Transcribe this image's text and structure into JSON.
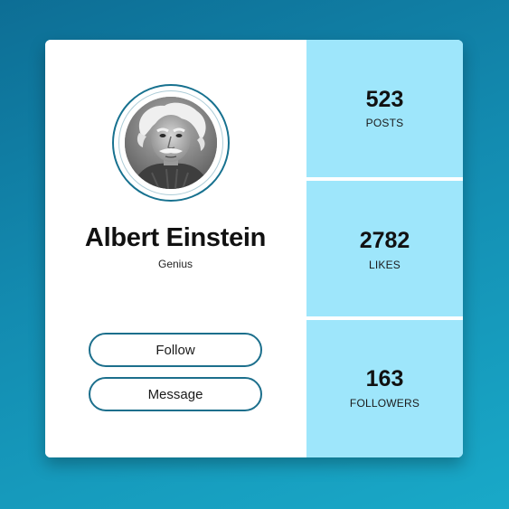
{
  "profile": {
    "name": "Albert Einstein",
    "subtitle": "Genius",
    "avatar_alt": "Albert Einstein portrait"
  },
  "actions": {
    "follow_label": "Follow",
    "message_label": "Message"
  },
  "stats": [
    {
      "value": "523",
      "label": "POSTS"
    },
    {
      "value": "2782",
      "label": "LIKES"
    },
    {
      "value": "163",
      "label": "FOLLOWERS"
    }
  ],
  "colors": {
    "background_top": "#0d6e95",
    "background_bottom": "#19a9c8",
    "card": "#ffffff",
    "stat_panel": "#9ee6fb",
    "accent_border": "#1c6f8c",
    "text": "#111111"
  }
}
